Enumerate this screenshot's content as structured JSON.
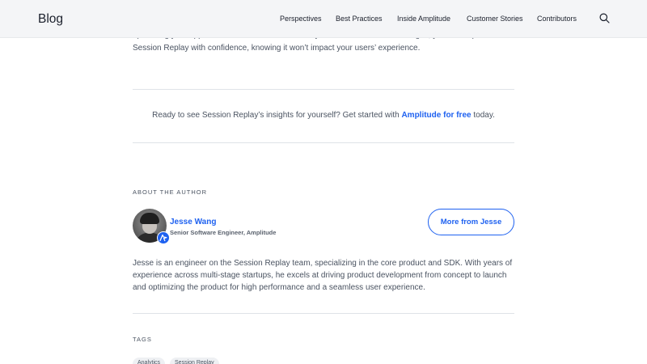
{
  "header": {
    "logo": "Blog",
    "nav": [
      {
        "label": "Perspectives"
      },
      {
        "label": "Best Practices"
      },
      {
        "label": "Inside Amplitude"
      },
      {
        "label": "Customer Stories"
      },
      {
        "label": "Contributors"
      }
    ],
    "search_icon": "search-icon"
  },
  "article": {
    "closing_paragraph": "optimizing your application to minimize unnecessary re-renders and DOM changes, you can implement Session Replay with confidence, knowing it won’t impact your users’ experience.",
    "cta": {
      "prefix": "Ready to see Session Replay’s insights for yourself? Get started with ",
      "link": "Amplitude for free",
      "suffix": " today."
    }
  },
  "author": {
    "section_label": "ABOUT THE AUTHOR",
    "name": "Jesse Wang",
    "role": "Senior Software Engineer, Amplitude",
    "more_button": "More from Jesse",
    "bio": "Jesse is an engineer on the Session Replay team, specializing in the core product and SDK. With years of experience across multi-stage startups, he excels at driving product development from concept to launch and optimizing the product for high performance and a seamless user experience."
  },
  "tags": {
    "section_label": "TAGS",
    "items": [
      "Analytics",
      "Session Replay"
    ]
  },
  "colors": {
    "accent": "#1e61f0",
    "header_bg": "#f4f5f7",
    "text": "#4a5361"
  }
}
